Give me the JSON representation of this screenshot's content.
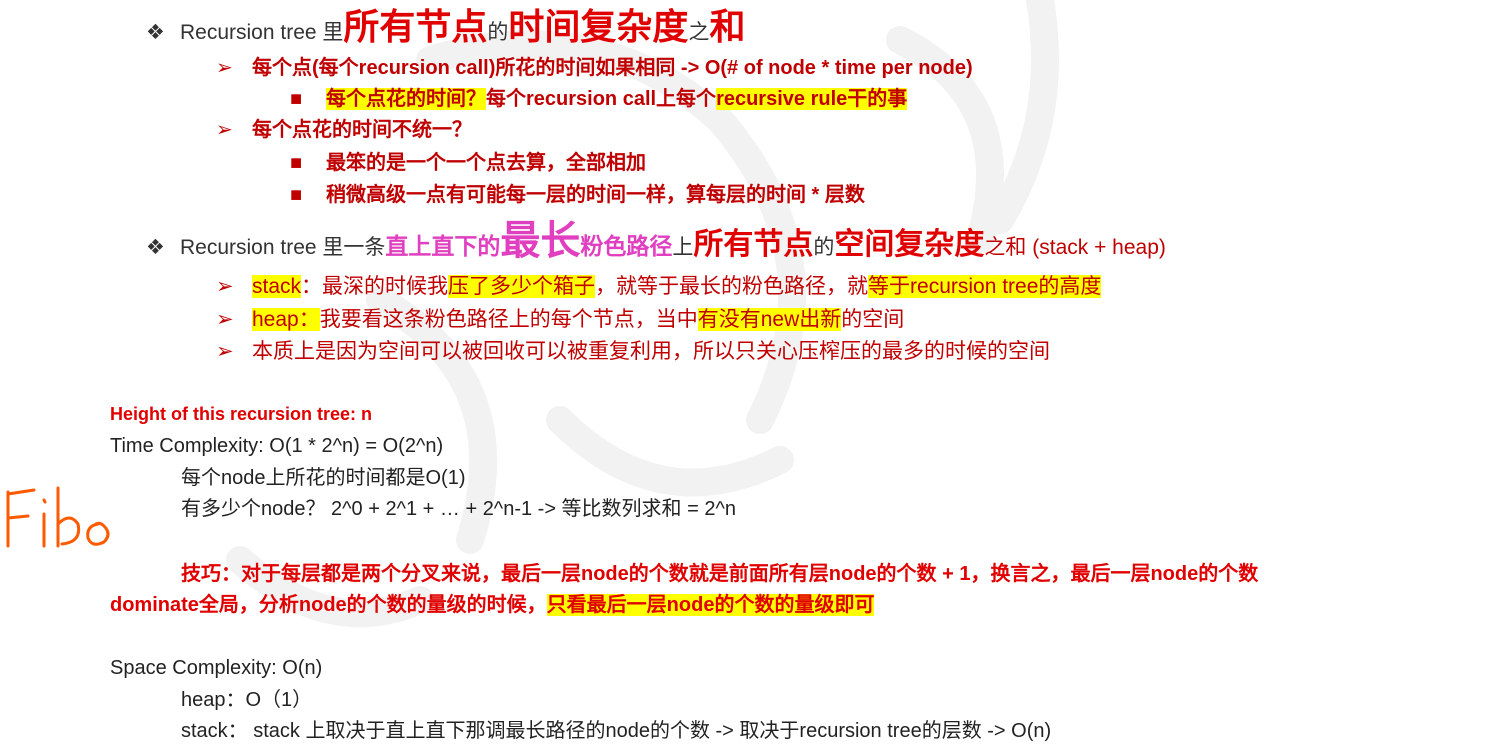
{
  "bullet1": {
    "prefix": "Recursion tree 里",
    "big1": "所有节点",
    "mid1": "的",
    "big2": "时间复杂度",
    "mid2": "之",
    "big3": "和"
  },
  "sub1": {
    "line": "每个点(每个recursion call)所花的时间如果相同 -> O(# of node * time per node)",
    "item1_part1": "每个点花的时间？",
    "item1_part2": "每个recursion call上每个",
    "item1_part3": "recursive rule干的事"
  },
  "sub2": {
    "line": "每个点花的时间不统一？",
    "item1": "最笨的是一个一个点去算，全部相加",
    "item2": "稍微高级一点有可能每一层的时间一样，算每层的时间 * 层数"
  },
  "bullet2": {
    "prefix": "Recursion tree 里一条",
    "pink1": "直上直下的",
    "pink2": "最长",
    "pink3": "粉色路径",
    "mid1": "上",
    "red1": "所有节点",
    "mid2": "的",
    "red2": "空间复杂度",
    "mid3": "之和 (stack + heap)"
  },
  "stack_line": {
    "label": "stack",
    "text1": "：最深的时候我",
    "text2": "压了多少个箱子",
    "text3": "，就等于最长的粉色路径，就",
    "text4": "等于recursion tree的高度"
  },
  "heap_line": {
    "label": "heap：",
    "text1": "我要看这条粉色路径上的每个节点，当中",
    "text2": "有没有new出新",
    "text3": "的空间"
  },
  "essence_line": "本质上是因为空间可以被回收可以被重复利用，所以只关心压榨压的最多的时候的空间",
  "height_line": "Height of this recursion tree: n",
  "time_line": "Time Complexity: O(1 * 2^n) = O(2^n)",
  "time_sub1": "每个node上所花的时间都是O(1)",
  "time_sub2": "有多少个node？ 2^0 + 2^1 + … + 2^n-1 -> 等比数列求和 = 2^n",
  "tip": {
    "line1": "技巧：对于每层都是两个分叉来说，最后一层node的个数就是前面所有层node的个数 + 1，换言之，最后一层node的个数",
    "line2a": "dominate全局，分析node的个数的量级的时候，",
    "line2b": "只看最后一层node的个数的量级即可"
  },
  "space_line": "Space Complexity:  O(n)",
  "space_heap": "heap：O（1）",
  "space_stack": "stack：  stack 上取决于直上直下那调最长路径的node的个数 -> 取决于recursion tree的层数 -> O(n)",
  "glyphs": {
    "diamond": "❖",
    "arrow": "➢",
    "square": "■"
  },
  "colors": {
    "red": "#c00000",
    "bright_red": "#e00000",
    "pink": "#e040c0",
    "highlight": "#ffff00",
    "handwriting": "#ff5a00"
  }
}
